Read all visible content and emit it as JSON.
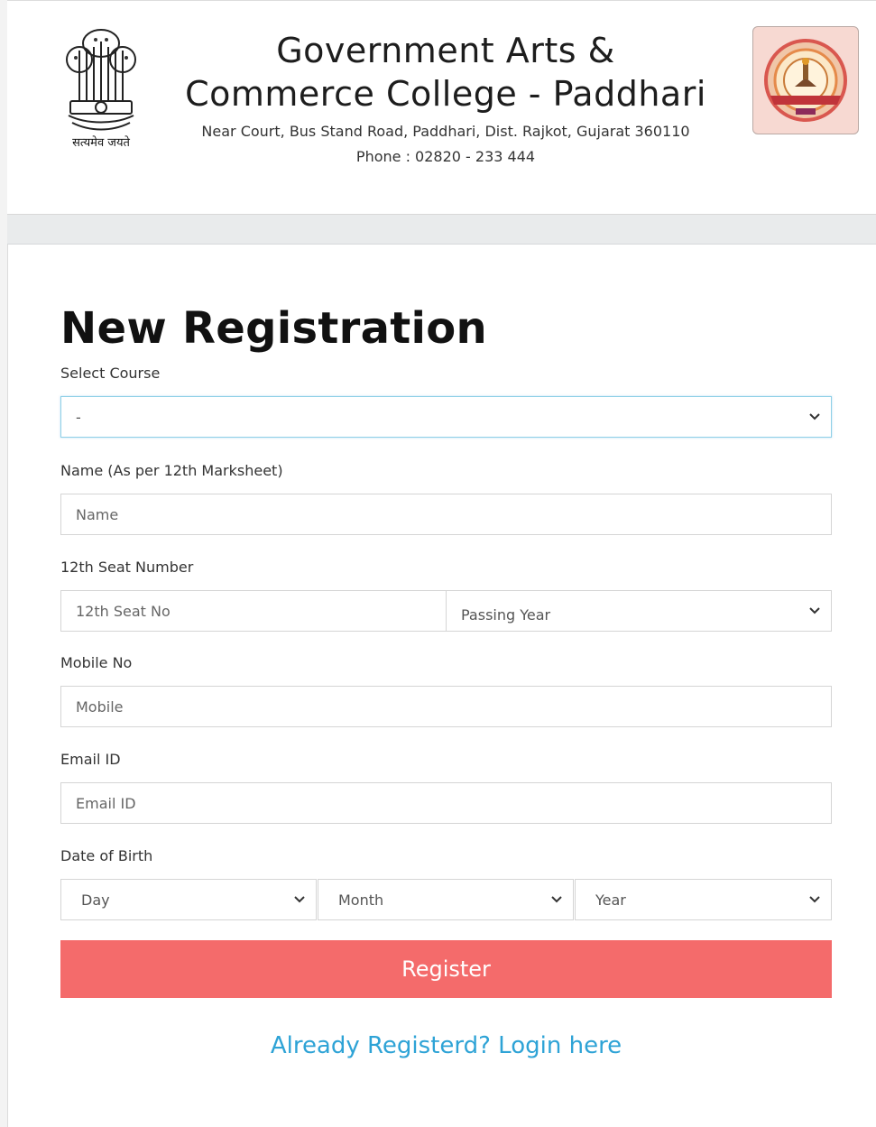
{
  "header": {
    "emblem_caption": "सत्यमेव जयते",
    "college_name": "Government Arts & Commerce College - Paddhari",
    "college_name_line1": "Government Arts &",
    "college_name_line2": "Commerce College - Paddhari",
    "address": "Near Court, Bus Stand Road, Paddhari, Dist. Rajkot, Gujarat 360110",
    "phone": "Phone : 02820 - 233 444"
  },
  "form": {
    "title": "New Registration",
    "course": {
      "label": "Select Course",
      "value": "-"
    },
    "name": {
      "label": "Name (As per 12th Marksheet)",
      "placeholder": "Name"
    },
    "seat": {
      "label": "12th Seat Number",
      "placeholder": "12th Seat No",
      "year_placeholder": "Passing Year"
    },
    "mobile": {
      "label": "Mobile No",
      "placeholder": "Mobile"
    },
    "email": {
      "label": "Email ID",
      "placeholder": "Email ID"
    },
    "dob": {
      "label": "Date of Birth",
      "day": "Day",
      "month": "Month",
      "year": "Year"
    },
    "register_label": "Register",
    "login_link": "Already Registerd? Login here"
  },
  "colors": {
    "register_bg": "#f46b6b",
    "link": "#2ea3d6",
    "focus_border": "#8fd0e6"
  }
}
